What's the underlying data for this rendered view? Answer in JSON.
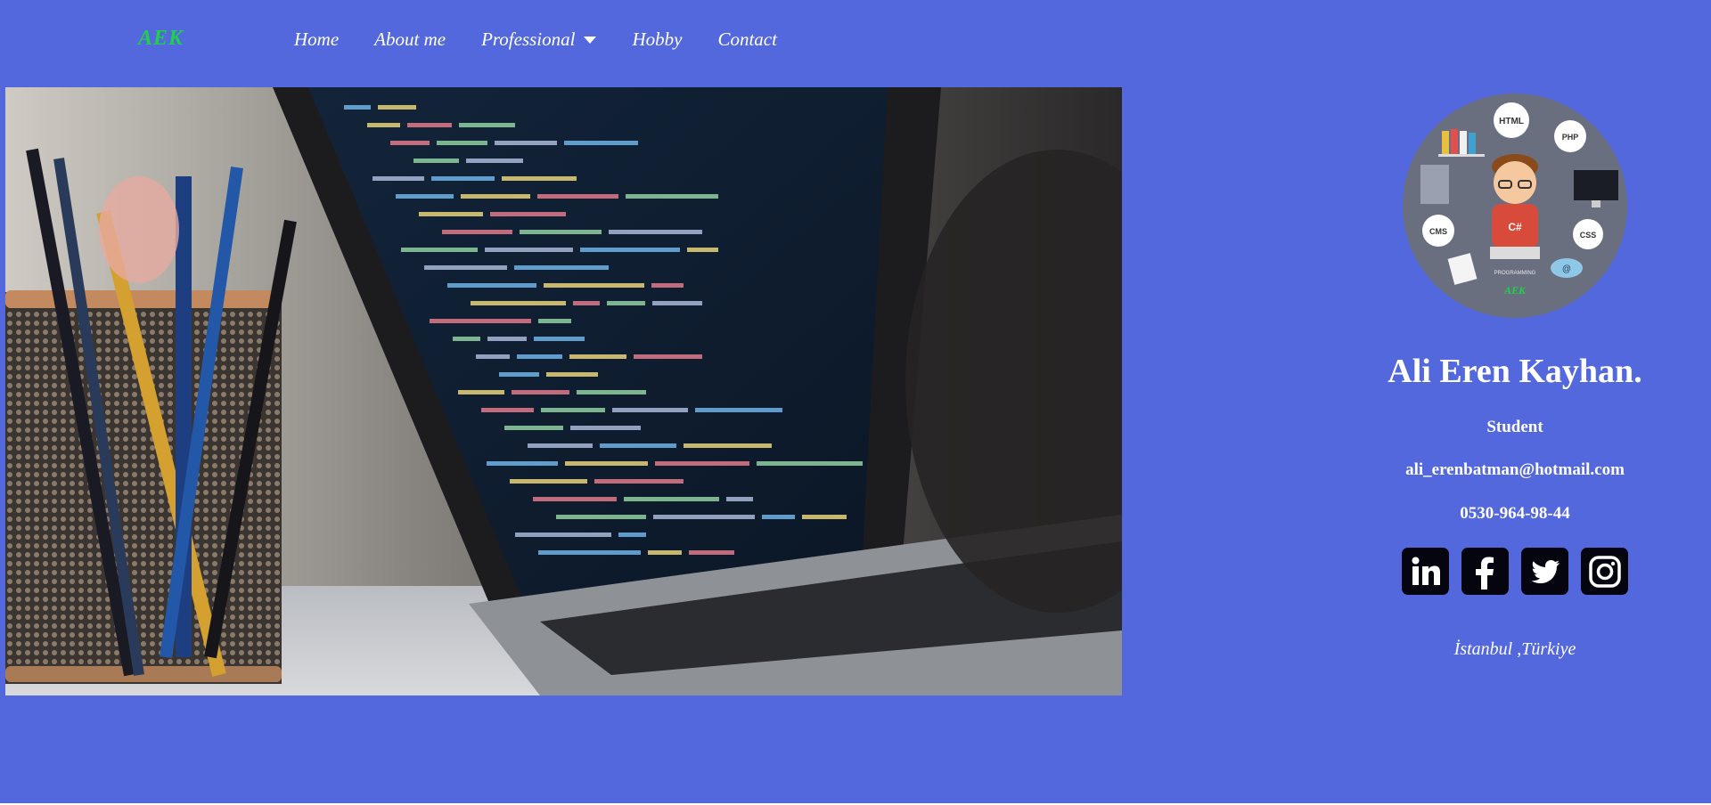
{
  "nav": {
    "logo": "AEK",
    "items": [
      {
        "label": "Home"
      },
      {
        "label": "About me"
      },
      {
        "label": "Professional",
        "has_dropdown": true
      },
      {
        "label": "Hobby"
      },
      {
        "label": "Contact"
      }
    ]
  },
  "hero": {
    "image": "laptop-code-icon"
  },
  "profile": {
    "avatar_tags": [
      "HTML",
      "PHP",
      "CMS",
      "CSS",
      "@"
    ],
    "avatar_shirt": "C#",
    "avatar_caption": "PROGRAMMING",
    "avatar_logo": "AEK",
    "name": "Ali Eren Kayhan.",
    "role": "Student",
    "email": "ali_erenbatman@hotmail.com",
    "phone": "0530-964-98-44",
    "socials": [
      {
        "icon": "linkedin-icon"
      },
      {
        "icon": "facebook-icon"
      },
      {
        "icon": "twitter-icon"
      },
      {
        "icon": "instagram-icon"
      }
    ],
    "location": "İstanbul ,Türkiye"
  },
  "colors": {
    "background": "#5468dd",
    "logo": "#1fd14a",
    "text": "#ffffff",
    "social_bg": "#050510"
  }
}
